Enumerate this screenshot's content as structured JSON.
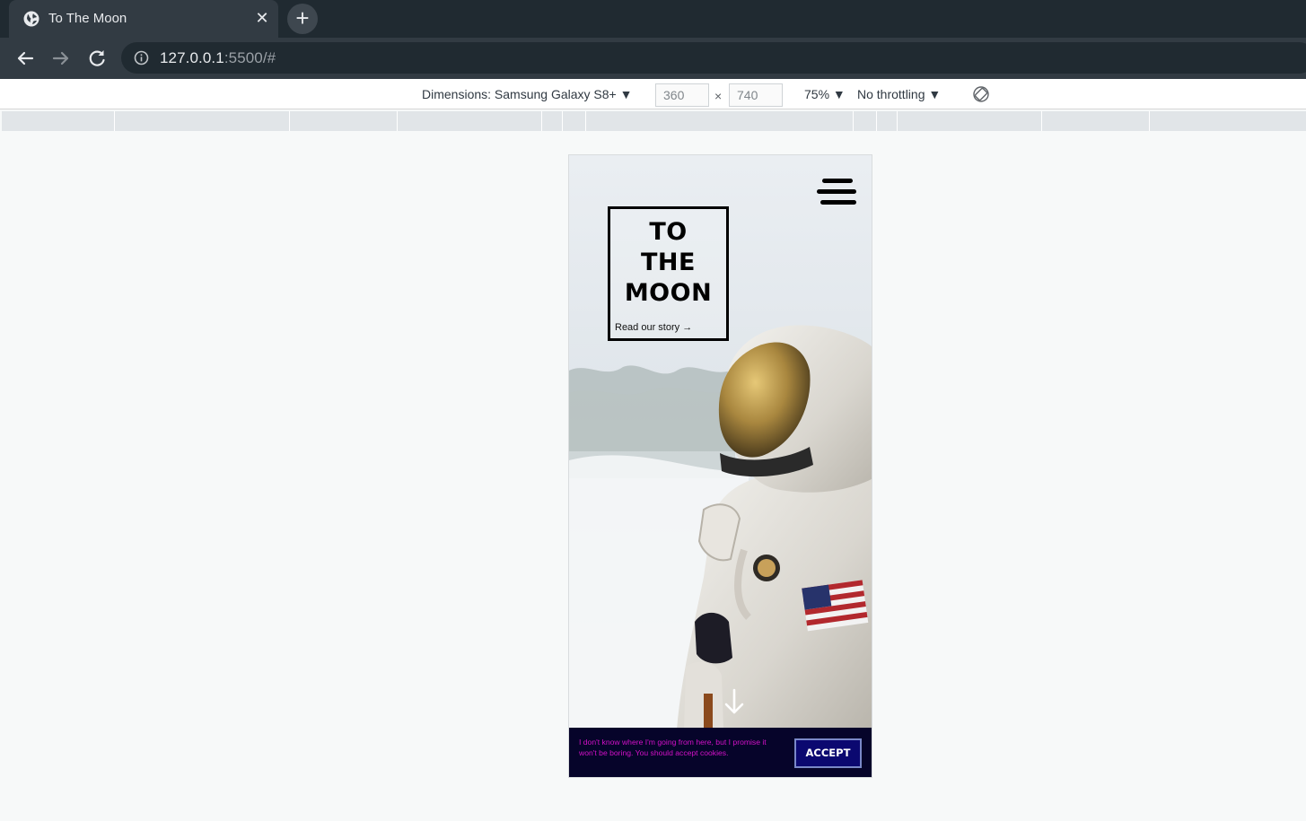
{
  "browser": {
    "tab_title": "To The Moon",
    "tab_close": "✕",
    "new_tab": "+",
    "url_host": "127.0.0.1",
    "url_rest": ":5500/#"
  },
  "devtools": {
    "dimensions_label": "Dimensions: Samsung Galaxy S8+",
    "width_value": "360",
    "times_sign": "×",
    "height_value": "740",
    "zoom": "75%",
    "throttling": "No throttling",
    "dropdown_arrow": "▼"
  },
  "page": {
    "logo_lines": [
      "TO",
      "THE",
      "MOON"
    ],
    "story_link": "Read our story",
    "story_arrow": "→",
    "cookie_text": "I don't know where I'm going from here, but I promise it won't be boring. You should accept cookies.",
    "accept_label": "ACCEPT"
  },
  "colors": {
    "browser_frame": "#202a31",
    "cookie_bg": "#06042a",
    "cookie_text": "#d411c8",
    "accept_bg": "#0b0870"
  }
}
